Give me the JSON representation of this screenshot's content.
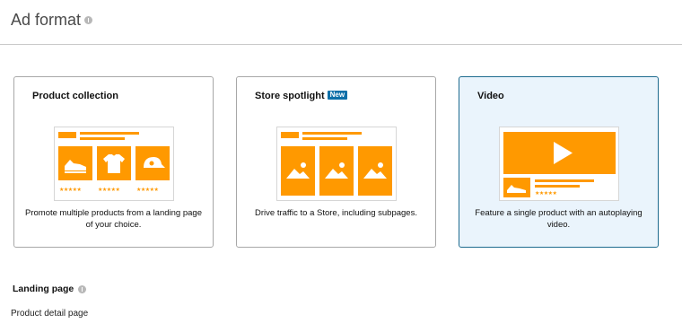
{
  "header": {
    "title": "Ad format"
  },
  "cards": [
    {
      "title": "Product collection",
      "badge": "",
      "description": "Promote multiple products from a landing page of your choice.",
      "selected": false,
      "star_text": "★★★★★"
    },
    {
      "title": "Store spotlight",
      "badge": "New",
      "description": "Drive traffic to a Store, including subpages.",
      "selected": false
    },
    {
      "title": "Video",
      "badge": "",
      "description": "Feature a single product with an autoplaying video.",
      "selected": true,
      "star_text": "★★★★★"
    }
  ],
  "landing_page": {
    "label": "Landing page",
    "value": "Product detail page"
  },
  "colors": {
    "accent": "#ff9900",
    "selected_bg": "#eaf4fc",
    "selected_border": "#1e6b8f",
    "badge": "#0d6fa8"
  },
  "icons": [
    "info-icon",
    "shoe-icon",
    "tshirt-icon",
    "cap-icon",
    "image-icon",
    "play-icon",
    "star-rating-icon"
  ]
}
